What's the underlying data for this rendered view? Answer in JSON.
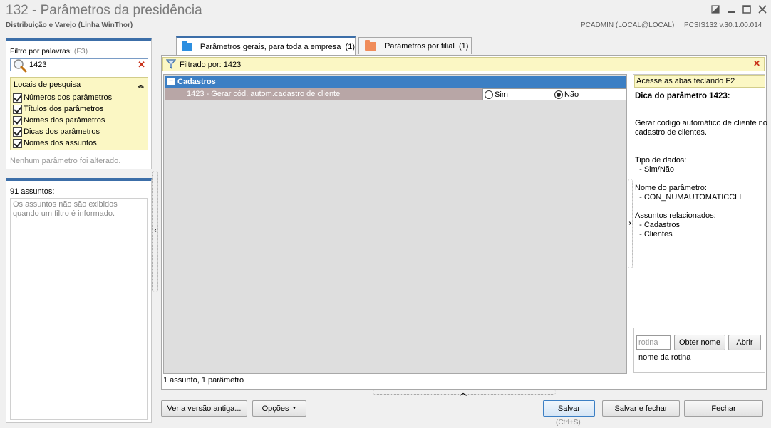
{
  "window": {
    "title": "132 - Parâmetros da presidência",
    "subtitle": "Distribuição e Varejo (Linha WinThor)",
    "user": "PCADMIN (LOCAL@LOCAL)",
    "version": "PCSIS132  v.30.1.00.014",
    "controls": [
      "restore-icon",
      "minimize-icon",
      "maximize-icon",
      "close-icon"
    ]
  },
  "filter": {
    "label": "Filtro por palavras:",
    "shortcut": "(F3)",
    "value": "1423",
    "locais_title": "Locais de pesquisa",
    "locais": [
      "Números dos parâmetros",
      "Títulos dos parâmetros",
      "Nomes dos parâmetros",
      "Dicas dos parâmetros",
      "Nomes dos assuntos"
    ],
    "status": "Nenhum parâmetro foi alterado."
  },
  "subjects": {
    "count_label": "91 assuntos:",
    "note": "Os assuntos não são exibidos quando um filtro é informado."
  },
  "tabs": [
    {
      "label": "Parâmetros gerais, para toda a empresa",
      "count": "(1)",
      "color": "#2d8fe0",
      "active": true
    },
    {
      "label": "Parâmetros por filial",
      "count": "(1)",
      "color": "#f08c5a",
      "active": false
    }
  ],
  "filter_bar": {
    "label": "Filtrado por: 1423"
  },
  "grid": {
    "group": "Cadastros",
    "row": {
      "label": "1423 - Gerar cód. autom.cadastro de cliente",
      "options": [
        "Sim",
        "Não"
      ],
      "selected": "Não"
    },
    "status": "1 assunto, 1 parâmetro"
  },
  "help": {
    "tip": "Acesse as abas teclando F2",
    "title": "Dica do parâmetro 1423:",
    "lines": [
      "Gerar código automático de cliente no",
      "cadastro de clientes.",
      "Tipo de dados:",
      "  - Sim/Não",
      "Nome do parâmetro:",
      "  - CON_NUMAUTOMATICCLI",
      "Assuntos relacionados:",
      "  - Cadastros",
      "  - Clientes"
    ],
    "rotina_placeholder": "rotina",
    "obter_label": "Obter nome",
    "abrir_label": "Abrir",
    "rotina_name_label": "nome da rotina"
  },
  "buttons": {
    "versao": "Ver a versão antiga...",
    "opcoes": "Opções",
    "salvar": "Salvar",
    "salvar_shortcut": "(Ctrl+S)",
    "salvar_fechar": "Salvar e fechar",
    "fechar": "Fechar"
  }
}
